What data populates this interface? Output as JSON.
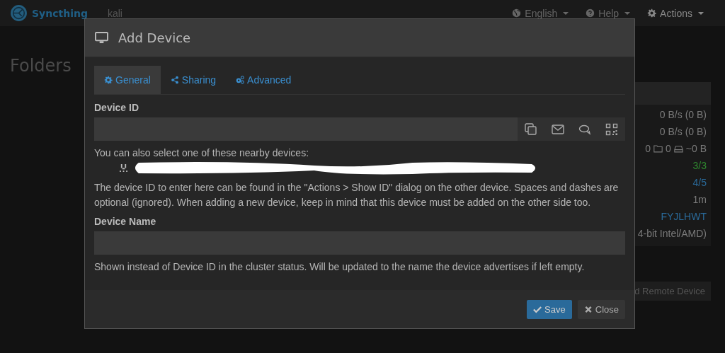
{
  "navbar": {
    "brand": "Syncthing",
    "device_name": "kali",
    "menus": [
      {
        "kind": "globe",
        "label": "English"
      },
      {
        "kind": "help",
        "label": "Help"
      },
      {
        "kind": "gear",
        "label": "Actions"
      }
    ]
  },
  "page": {
    "heading": "Folders",
    "device_panel": [
      {
        "kind": "text",
        "value": "0 B/s (0 B)",
        "color": "#7a7a7a"
      },
      {
        "kind": "text",
        "value": "0 B/s (0 B)",
        "color": "#7a7a7a"
      },
      {
        "kind": "counts",
        "values": [
          "0",
          "0",
          "~0 B"
        ],
        "color": "#7a7a7a"
      },
      {
        "kind": "text",
        "value": "3/3",
        "color": "#2f8a2f"
      },
      {
        "kind": "text",
        "value": "4/5",
        "color": "#2a6a9a"
      },
      {
        "kind": "text",
        "value": "1m",
        "color": "#7a7a7a"
      },
      {
        "kind": "text",
        "value": "FYJLHWT",
        "color": "#2a6a9a"
      },
      {
        "kind": "text",
        "value": "4-bit Intel/AMD)",
        "color": "#7a7a7a"
      }
    ],
    "add_button": "d Remote Device"
  },
  "modal": {
    "title": "Add Device",
    "tabs": [
      {
        "kind": "gear",
        "label": "General",
        "selected": true
      },
      {
        "kind": "share",
        "label": "Sharing",
        "selected": false
      },
      {
        "kind": "gears",
        "label": "Advanced",
        "selected": false
      }
    ],
    "device_id": {
      "label": "Device ID",
      "addons": [
        {
          "kind": "copy"
        },
        {
          "kind": "mail"
        },
        {
          "kind": "chat"
        },
        {
          "kind": "qr"
        }
      ]
    },
    "nearby_hint": "You can also select one of these nearby devices:",
    "nearby_devices": [
      {
        "redacted": true
      }
    ],
    "device_id_help": "The device ID to enter here can be found in the \"Actions > Show ID\" dialog on the other device. Spaces and dashes are optional (ignored). When adding a new device, keep in mind that this device must be added on the other side too.",
    "device_name": {
      "label": "Device Name"
    },
    "device_name_help": "Shown instead of Device ID in the cluster status. Will be updated to the name the device advertises if left empty.",
    "buttons": [
      {
        "kind": "primary",
        "label": "Save"
      },
      {
        "kind": "default",
        "label": "Close"
      }
    ]
  }
}
